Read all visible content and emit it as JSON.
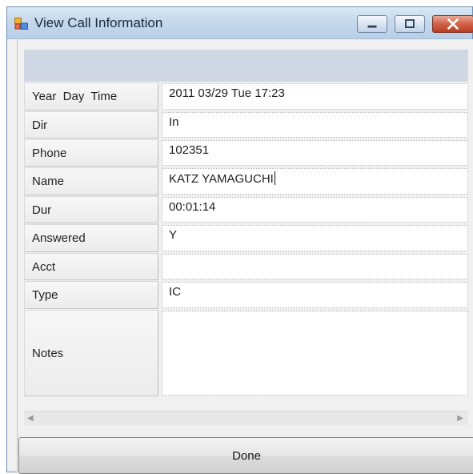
{
  "window": {
    "title": "View Call Information",
    "icons": {
      "app": "application-window-icon",
      "minimize": "minimize-icon",
      "maximize": "maximize-icon",
      "close": "close-icon"
    }
  },
  "fields": [
    {
      "label": "Year  Day  Time",
      "value": "2011 03/29 Tue 17:23"
    },
    {
      "label": "Dir",
      "value": "In"
    },
    {
      "label": "Phone",
      "value": "102351"
    },
    {
      "label": "Name",
      "value": "KATZ YAMAGUCHI"
    },
    {
      "label": "Dur",
      "value": "00:01:14"
    },
    {
      "label": "Answered",
      "value": "Y"
    },
    {
      "label": "Acct",
      "value": ""
    },
    {
      "label": "Type",
      "value": "IC"
    },
    {
      "label": "Notes",
      "value": ""
    }
  ],
  "scrollbar": {
    "left_arrow": "◀",
    "right_arrow": "▶"
  },
  "actions": {
    "done_label": "Done"
  }
}
